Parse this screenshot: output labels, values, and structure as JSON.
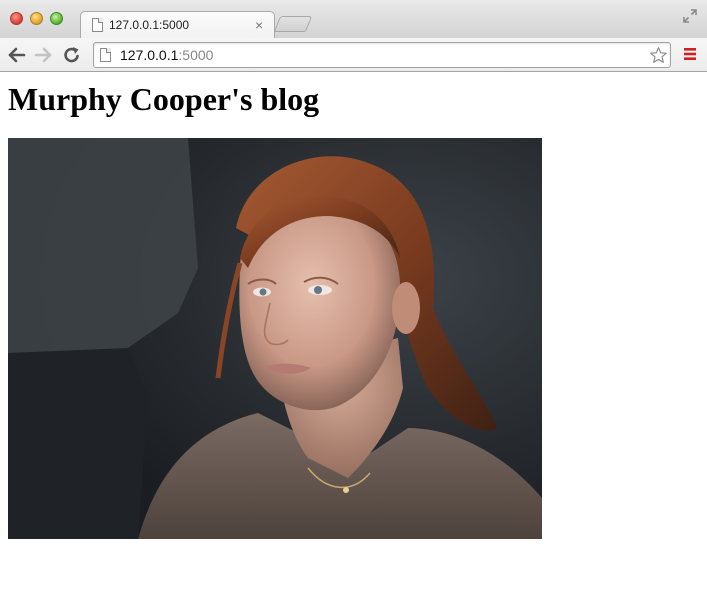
{
  "browser": {
    "tab": {
      "title": "127.0.0.1:5000",
      "close_glyph": "×"
    },
    "omnibox": {
      "host": "127.0.0.1",
      "port": ":5000"
    },
    "icons": {
      "back": "arrow-left-icon",
      "forward": "arrow-right-icon",
      "reload": "reload-icon",
      "bookmark": "star-icon",
      "menu": "hamburger-menu-icon",
      "fullscreen": "fullscreen-icon",
      "page": "page-icon"
    },
    "colors": {
      "menu_accent": "#cc2222"
    }
  },
  "page": {
    "title": "Murphy Cooper's blog",
    "photo": {
      "subject": "photo-of-woman"
    }
  }
}
